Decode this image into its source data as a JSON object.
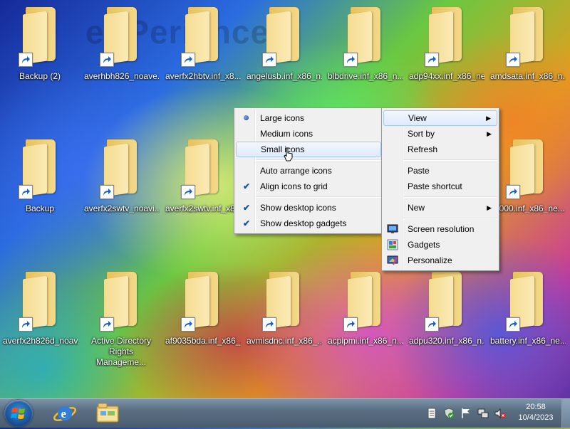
{
  "watermark": "eXPerience",
  "desktop": {
    "row1": [
      "Backup (2)",
      "averhbh826_noave...",
      "averfx2hbtv.inf_x8...",
      "angelusb.inf_x86_n...",
      "blbdrive.inf_x86_n...",
      "adp94xx.inf_x86_ne...",
      "amdsata.inf_x86_n..."
    ],
    "row2": [
      "Backup",
      "averfx2swtv_noavi...",
      "averfx2swtv.inf_x8...",
      "k2000.inf_x86_ne..."
    ],
    "row3": [
      "averfx2h826d_noav...",
      "Active Directory\nRights Manageme...",
      "af9035bda.inf_x86_...",
      "avmisdnc.inf_x86_...",
      "acpipmi.inf_x86_n...",
      "adpu320.inf_x86_n...",
      "battery.inf_x86_ne..."
    ]
  },
  "context_menu": {
    "items": [
      {
        "label": "View",
        "submenu": true,
        "highlighted": true
      },
      {
        "label": "Sort by",
        "submenu": true
      },
      {
        "label": "Refresh"
      },
      {
        "label": "Paste"
      },
      {
        "label": "Paste shortcut"
      },
      {
        "label": "New",
        "submenu": true
      },
      {
        "label": "Screen resolution",
        "icon": "display-icon"
      },
      {
        "label": "Gadgets",
        "icon": "gadgets-icon"
      },
      {
        "label": "Personalize",
        "icon": "personalize-icon"
      }
    ]
  },
  "view_submenu": {
    "items": [
      {
        "label": "Large icons",
        "selected": true
      },
      {
        "label": "Medium icons"
      },
      {
        "label": "Small icons",
        "hover": true
      },
      {
        "label": "Auto arrange icons"
      },
      {
        "label": "Align icons to grid",
        "checked": true
      },
      {
        "label": "Show desktop icons",
        "checked": true
      },
      {
        "label": "Show desktop gadgets",
        "checked": true
      }
    ]
  },
  "taskbar": {
    "pinned": [
      "internet-explorer-icon",
      "windows-explorer-icon"
    ],
    "tray_icons": [
      "action-center-doc-icon",
      "security-shield-icon",
      "flag-icon",
      "network-icon",
      "volume-muted-icon"
    ],
    "time": "20:58",
    "date": "10/4/2023"
  },
  "colors": {
    "menu_bg": "#f0f0f0",
    "menu_border": "#979797",
    "hover_bg": "#dfeafa",
    "hover_border": "#a8c8ec",
    "taskbar": "#5a6e82"
  }
}
